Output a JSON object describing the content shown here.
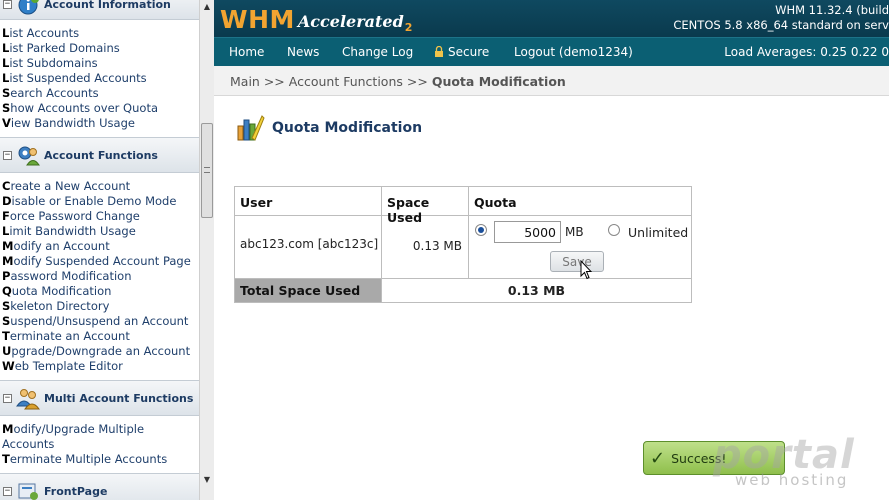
{
  "sidebar": {
    "account_info": {
      "title": "Account Information",
      "items": [
        {
          "first": "L",
          "rest": "ist Accounts"
        },
        {
          "first": "L",
          "rest": "ist Parked Domains"
        },
        {
          "first": "L",
          "rest": "ist Subdomains"
        },
        {
          "first": "L",
          "rest": "ist Suspended Accounts"
        },
        {
          "first": "S",
          "rest": "earch Accounts"
        },
        {
          "first": "S",
          "rest": "how Accounts over Quota"
        },
        {
          "first": "V",
          "rest": "iew Bandwidth Usage"
        }
      ]
    },
    "account_functions": {
      "title": "Account Functions",
      "items": [
        {
          "first": "C",
          "rest": "reate a New Account"
        },
        {
          "first": "D",
          "rest": "isable or Enable Demo Mode"
        },
        {
          "first": "F",
          "rest": "orce Password Change"
        },
        {
          "first": "L",
          "rest": "imit Bandwidth Usage"
        },
        {
          "first": "M",
          "rest": "odify an Account"
        },
        {
          "first": "M",
          "rest": "odify Suspended Account Page"
        },
        {
          "first": "P",
          "rest": "assword Modification"
        },
        {
          "first": "Q",
          "rest": "uota Modification"
        },
        {
          "first": "S",
          "rest": "keleton Directory"
        },
        {
          "first": "S",
          "rest": "uspend/Unsuspend an Account"
        },
        {
          "first": "T",
          "rest": "erminate an Account"
        },
        {
          "first": "U",
          "rest": "pgrade/Downgrade an Account"
        },
        {
          "first": "W",
          "rest": "eb Template Editor"
        }
      ]
    },
    "multi_account": {
      "title": "Multi Account Functions",
      "items": [
        {
          "first": "M",
          "rest": "odify/Upgrade Multiple"
        },
        {
          "first": "",
          "rest": "Accounts"
        },
        {
          "first": "T",
          "rest": "erminate Multiple Accounts"
        }
      ]
    },
    "frontpage": {
      "title": "FrontPage"
    },
    "toggle_symbol": "−"
  },
  "header": {
    "logo_whm": "WHM",
    "logo_accelerated": "Accelerated",
    "logo_version": "2",
    "version_line1": "WHM 11.32.4 (build",
    "version_line2": "CENTOS 5.8 x86_64 standard on serv"
  },
  "nav": {
    "home": "Home",
    "news": "News",
    "changelog": "Change Log",
    "secure": "Secure",
    "logout": "Logout (demo1234)",
    "load": "Load Averages: 0.25 0.22 0"
  },
  "breadcrumb": {
    "main": "Main",
    "sep": ">>",
    "functions": "Account Functions",
    "current": "Quota Modification"
  },
  "page": {
    "title": "Quota Modification"
  },
  "table": {
    "headers": {
      "user": "User",
      "space_used": "Space Used",
      "quota": "Quota"
    },
    "row": {
      "user": "abc123.com [abc123c]",
      "space_used": "0.13 MB"
    },
    "quota_value": "5000",
    "quota_unit": "MB",
    "unlimited_label": "Unlimited",
    "save_label": "Save",
    "total_label": "Total Space Used",
    "total_value": "0.13 MB"
  },
  "status": {
    "success": "Success!"
  },
  "watermark": {
    "brand": "portal",
    "tagline": "web hosting"
  },
  "colors": {
    "header_bg": "#0a3a4d",
    "nav_bg": "#0b5f73",
    "logo_orange": "#f2a431",
    "link_blue": "#1f3f6b",
    "success_green": "#8fbf4c"
  },
  "icons": {
    "section_info": "info-icon",
    "section_functions": "gear-user-icon",
    "section_multi": "users-icon",
    "section_frontpage": "frontpage-icon",
    "nav_secure": "lock-icon",
    "page": "quota-chart-icon",
    "success": "checkmark-icon"
  }
}
